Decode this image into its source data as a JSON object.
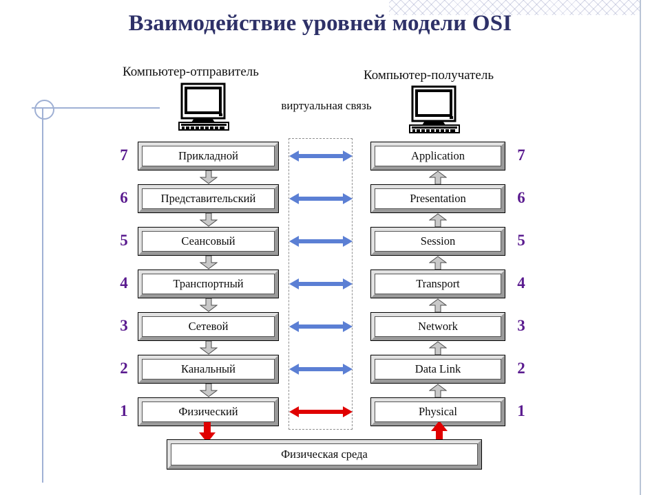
{
  "title": "Взаимодействие уровней модели OSI",
  "headers": {
    "sender": "Компьютер-отправитель",
    "receiver": "Компьютер-получатель"
  },
  "virtual_link_label": "виртуальная связь",
  "icons": {
    "sender_computer": "desktop-computer-icon",
    "receiver_computer": "desktop-computer-icon"
  },
  "layers": {
    "numbers": [
      "7",
      "6",
      "5",
      "4",
      "3",
      "2",
      "1"
    ],
    "left": [
      "Прикладной",
      "Представительский",
      "Сеансовый",
      "Транспортный",
      "Сетевой",
      "Канальный",
      "Физический"
    ],
    "right": [
      "Application",
      "Presentation",
      "Session",
      "Transport",
      "Network",
      "Data Link",
      "Physical"
    ]
  },
  "virtual_arrows": [
    {
      "level": "7",
      "color": "#5b7fd4",
      "kind": "double-headed-arrow"
    },
    {
      "level": "6",
      "color": "#5b7fd4",
      "kind": "double-headed-arrow"
    },
    {
      "level": "5",
      "color": "#5b7fd4",
      "kind": "double-headed-arrow"
    },
    {
      "level": "4",
      "color": "#5b7fd4",
      "kind": "double-headed-arrow"
    },
    {
      "level": "3",
      "color": "#5b7fd4",
      "kind": "double-headed-arrow"
    },
    {
      "level": "2",
      "color": "#5b7fd4",
      "kind": "double-headed-arrow"
    },
    {
      "level": "1",
      "color": "#e00000",
      "kind": "double-headed-arrow"
    }
  ],
  "physical_medium": "Физическая среда",
  "colors": {
    "title": "#2e3168",
    "layer_number": "#5a1b8f",
    "virtual_arrow": "#5b7fd4",
    "physical_arrow": "#e00000",
    "box_fill": "#c3c3c3",
    "box_inner": "#ffffff",
    "deco_line": "#9fb0d4"
  },
  "flow": {
    "left_direction": "down",
    "right_direction": "up"
  }
}
